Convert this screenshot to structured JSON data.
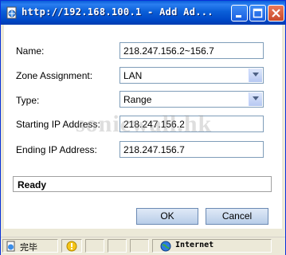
{
  "window": {
    "title": "http://192.168.100.1 - Add Ad...",
    "icons": [
      "ie-page-icon",
      "minimize-icon",
      "maximize-icon",
      "close-icon"
    ]
  },
  "form": {
    "name_label": "Name:",
    "name_value": "218.247.156.2~156.7",
    "zone_label": "Zone Assignment:",
    "zone_value": "LAN",
    "type_label": "Type:",
    "type_value": "Range",
    "start_label": "Starting IP Address:",
    "start_value": "218.247.156.2",
    "end_label": "Ending IP Address:",
    "end_value": "218.247.156.7"
  },
  "watermark": "sonicwall.hk",
  "status": "Ready",
  "buttons": {
    "ok": "OK",
    "cancel": "Cancel"
  },
  "statusbar": {
    "done": "完毕",
    "zone": "Internet"
  },
  "colors": {
    "title_bar": "#0a5fd8",
    "field_border": "#7f9db9",
    "button": "#c5d6ee"
  }
}
